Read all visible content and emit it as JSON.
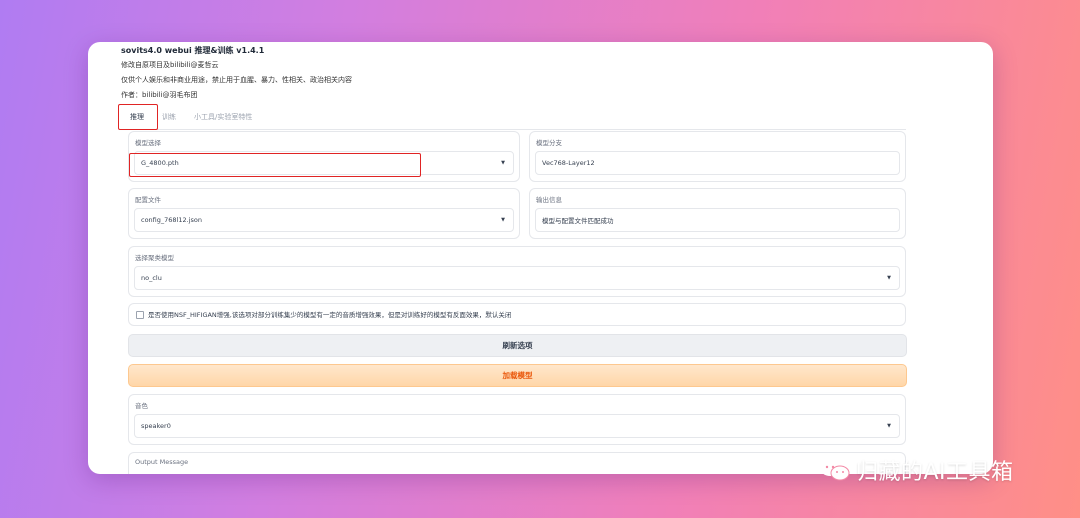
{
  "header": {
    "title": "sovits4.0 webui 推理&训练 v1.4.1",
    "line1": "修改自原项目及bilibili@麦哲云",
    "line2": "仅供个人娱乐和非商业用途，禁止用于血腥、暴力、性相关、政治相关内容",
    "line3": "作者：bilibili@羽毛布团"
  },
  "tabs": [
    {
      "label": "推理",
      "active": true
    },
    {
      "label": "训练",
      "active": false
    },
    {
      "label": "小工具/实验室特性",
      "active": false
    }
  ],
  "model_select": {
    "label": "模型选择",
    "value": "G_4800.pth"
  },
  "model_branch": {
    "label": "模型分支",
    "value": "Vec768-Layer12"
  },
  "config_file": {
    "label": "配置文件",
    "value": "config_768l12.json"
  },
  "output_info": {
    "label": "输出信息",
    "value": "模型与配置文件匹配成功"
  },
  "cluster_model": {
    "label": "选择聚类模型",
    "value": "no_clu"
  },
  "nsf_checkbox": {
    "label": "是否使用NSF_HIFIGAN增强,该选项对部分训练集少的模型有一定的音质增强效果，但是对训练好的模型有反面效果，默认关闭",
    "checked": false
  },
  "refresh_button": {
    "label": "刷新选项"
  },
  "load_button": {
    "label": "加载模型"
  },
  "speaker": {
    "label": "音色",
    "value": "speaker0"
  },
  "output_message": {
    "label": "Output Message"
  },
  "watermark": {
    "text": "归藏的AI工具箱"
  },
  "colors": {
    "highlight": "#e02424",
    "load_text": "#ea580c",
    "load_bg": "#ffd6a8"
  }
}
